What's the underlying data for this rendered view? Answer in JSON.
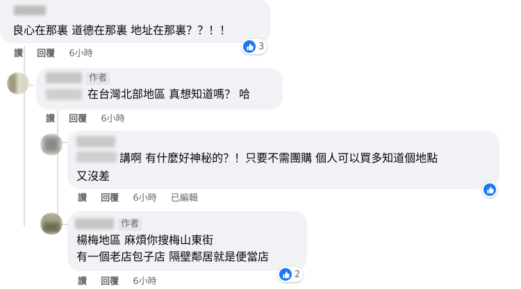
{
  "comments": [
    {
      "text": "良心在那裏 道德在那裏 地址在那裏？？！！",
      "actions": {
        "like": "讚",
        "reply": "回覆",
        "time": "6小時"
      },
      "reactions": "3"
    },
    {
      "author_badge": "作者",
      "text": "在台灣北部地區 真想知道嗎？ 哈",
      "actions": {
        "like": "讚",
        "reply": "回覆",
        "time": "6小時"
      }
    },
    {
      "text_line1": "講啊 有什麼好神秘的？！只要不需團購 個人可以買多知道個地點",
      "text_line2": "又沒差",
      "actions": {
        "like": "讚",
        "reply": "回覆",
        "time": "6小時",
        "edited": "已編輯"
      }
    },
    {
      "author_badge": "作者",
      "text_line1": "楊梅地區 麻煩你搜梅山東街",
      "text_line2": "有一個老店包子店 隔壁鄰居就是便當店",
      "actions": {
        "like": "讚",
        "reply": "回覆",
        "time": "6小時"
      },
      "reactions": "2"
    }
  ],
  "colors": {
    "bubble": "#f0f2f5",
    "like_blue": "#1877f2",
    "meta_gray": "#65676b"
  },
  "icons": {
    "like": "thumbs-up-icon"
  }
}
